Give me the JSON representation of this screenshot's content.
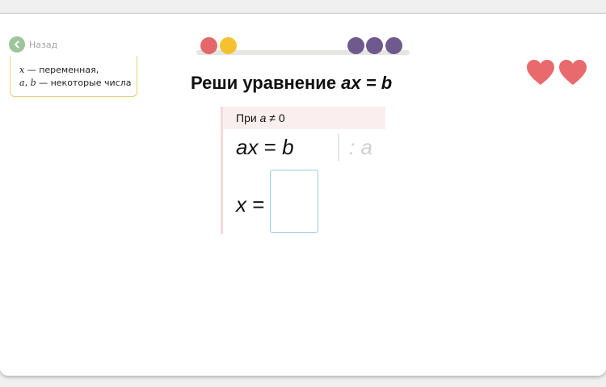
{
  "nav": {
    "back_label": "Назад"
  },
  "hint": {
    "line1_var": "x",
    "line1_text": " — переменная,",
    "line2_var_a": "a",
    "line2_sep": ", ",
    "line2_var_b": "b",
    "line2_text": " — некоторые числа"
  },
  "progress": {
    "dots": [
      {
        "color": "#e4686a",
        "state": "wrong"
      },
      {
        "color": "#f5c12e",
        "state": "current"
      },
      {
        "color": "#6e5a8c",
        "state": "pending"
      },
      {
        "color": "#6e5a8c",
        "state": "pending"
      },
      {
        "color": "#6e5a8c",
        "state": "pending"
      }
    ]
  },
  "lives": {
    "count": 2,
    "icon": "heart-icon",
    "color": "#e86a6c"
  },
  "task": {
    "title_prefix": "Реши уравнение ",
    "title_equation": "ax = b"
  },
  "solution": {
    "condition_prefix": "При ",
    "condition_var": "a",
    "condition_suffix": " ≠ 0",
    "equation_lhs": "ax",
    "equation_eq": " = ",
    "equation_rhs": "b",
    "divide_hint": ": a",
    "answer_lhs": "x",
    "answer_eq": " =",
    "answer_value": ""
  }
}
